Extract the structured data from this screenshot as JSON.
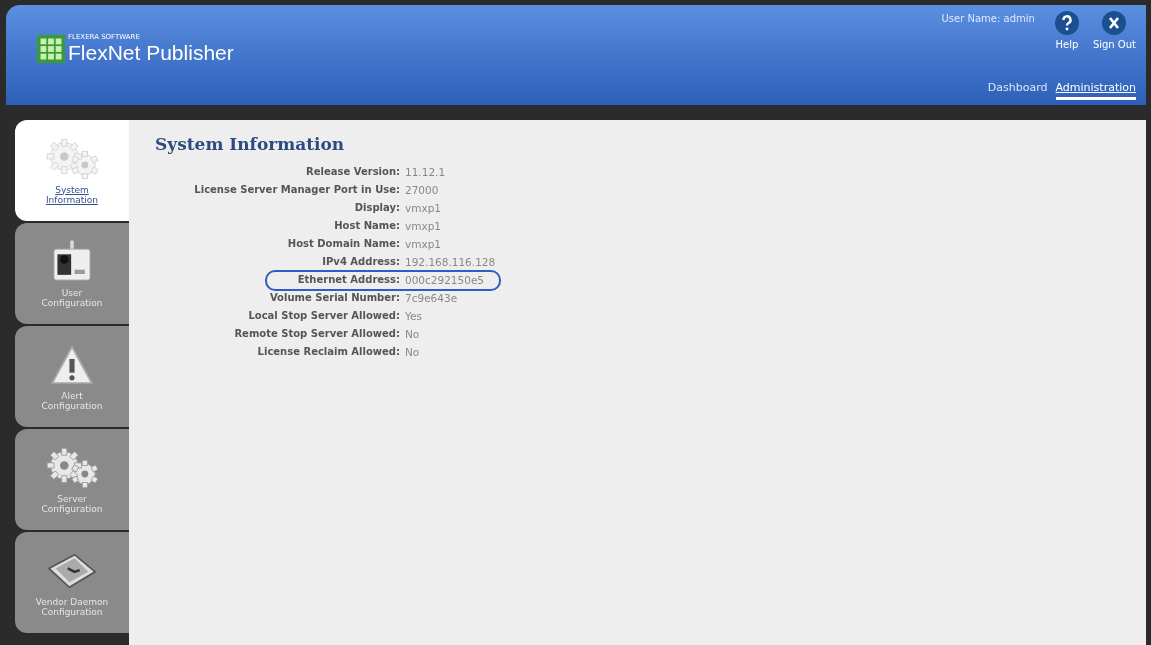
{
  "header": {
    "brand_small": "FLEXERA SOFTWARE",
    "brand": "FlexNet Publisher",
    "user_label": "User Name: admin",
    "actions": [
      {
        "kind": "help",
        "label": "Help"
      },
      {
        "kind": "signout",
        "label": "Sign Out"
      }
    ],
    "nav": [
      {
        "label": "Dashboard",
        "selected": false
      },
      {
        "label": "Administration",
        "selected": true
      }
    ]
  },
  "sidebar": {
    "tabs": [
      {
        "kind": "gears-faded",
        "label": "System Information",
        "selected": true
      },
      {
        "kind": "badge",
        "label": "User Configuration",
        "selected": false
      },
      {
        "kind": "warning",
        "label": "Alert Configuration",
        "selected": false
      },
      {
        "kind": "gears",
        "label": "Server Configuration",
        "selected": false
      },
      {
        "kind": "tablet",
        "label": "Vendor Daemon Configuration",
        "selected": false
      }
    ]
  },
  "content": {
    "title": "System Information",
    "rows": [
      {
        "label": "Release Version:",
        "value": "11.12.1",
        "highlighted": false
      },
      {
        "label": "License Server Manager Port in Use:",
        "value": "27000",
        "highlighted": false
      },
      {
        "label": "Display:",
        "value": "vmxp1",
        "highlighted": false
      },
      {
        "label": "Host Name:",
        "value": "vmxp1",
        "highlighted": false
      },
      {
        "label": "Host Domain Name:",
        "value": "vmxp1",
        "highlighted": false
      },
      {
        "label": "IPv4 Address:",
        "value": "192.168.116.128",
        "highlighted": false
      },
      {
        "label": "Ethernet Address:",
        "value": "000c292150e5",
        "highlighted": true
      },
      {
        "label": "Volume Serial Number:",
        "value": "7c9e643e",
        "highlighted": false
      },
      {
        "label": "Local Stop Server Allowed:",
        "value": "Yes",
        "highlighted": false
      },
      {
        "label": "Remote Stop Server Allowed:",
        "value": "No",
        "highlighted": false
      },
      {
        "label": "License Reclaim Allowed:",
        "value": "No",
        "highlighted": false
      }
    ]
  }
}
